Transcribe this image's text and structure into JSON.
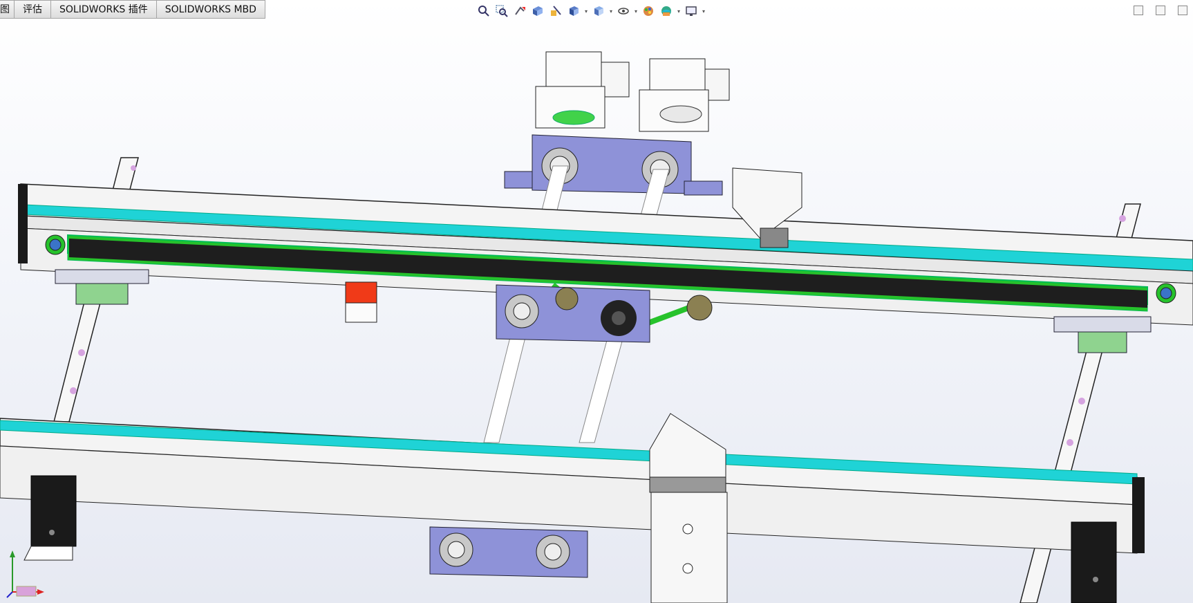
{
  "tabs": [
    {
      "label": "图"
    },
    {
      "label": "评估"
    },
    {
      "label": "SOLIDWORKS 插件"
    },
    {
      "label": "SOLIDWORKS MBD"
    }
  ],
  "toolbar": {
    "icons": [
      "zoom-to-fit-icon",
      "zoom-to-area-icon",
      "previous-view-icon",
      "section-view-icon",
      "dynamic-annotation-icon",
      "view-orientation-icon",
      "display-style-icon",
      "hide-show-items-icon",
      "edit-appearance-icon",
      "apply-scene-icon",
      "view-settings-icon"
    ]
  },
  "colors": {
    "rail": "#f4f4f4",
    "belt_cyan": "#1fd3d6",
    "chain_green": "#26c22c",
    "dark_plate": "#1e1e1e",
    "bearing_block": "#8e92d8",
    "guide_rail_green": "#8fd38f",
    "red_block": "#f03a18",
    "motor_white": "#fbfbfb"
  }
}
